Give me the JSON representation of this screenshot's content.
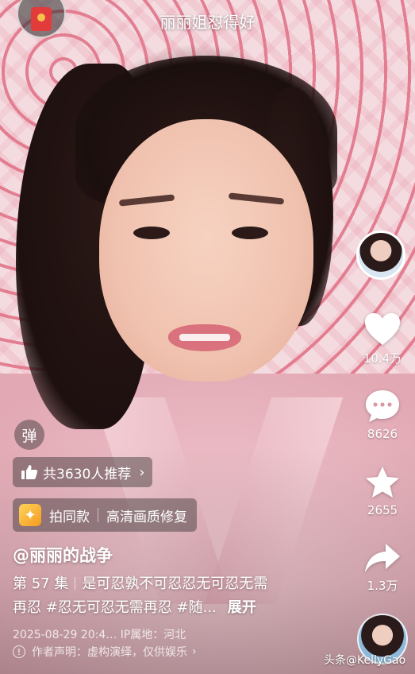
{
  "caption": "丽丽姐怼得好",
  "side": {
    "likes": "10.4万",
    "comments": "8626",
    "favorites": "2655",
    "shares": "1.3万"
  },
  "danmu_label": "弹",
  "recommend": {
    "label": "共3630人推荐"
  },
  "effects": {
    "shoot_same": "拍同款",
    "hd_repair": "高清画质修复"
  },
  "author": "@丽丽的战争",
  "description": {
    "episode": "第 57 集",
    "line1": "是可忍孰不可忍忍无可忍无需",
    "line2": "再忍 #忍无可忍无需再忍 #随...",
    "expand": "展开"
  },
  "meta": "2025-08-29 20:4… IP属地：河北",
  "notice": "作者声明：虚构演绎，仅供娱乐",
  "watermark": "头条@KellyGao",
  "icons": {
    "redpacket": "red-envelope-icon",
    "like": "heart-icon",
    "comment": "comment-bubble-icon",
    "favorite": "star-icon",
    "share": "share-arrow-icon"
  }
}
